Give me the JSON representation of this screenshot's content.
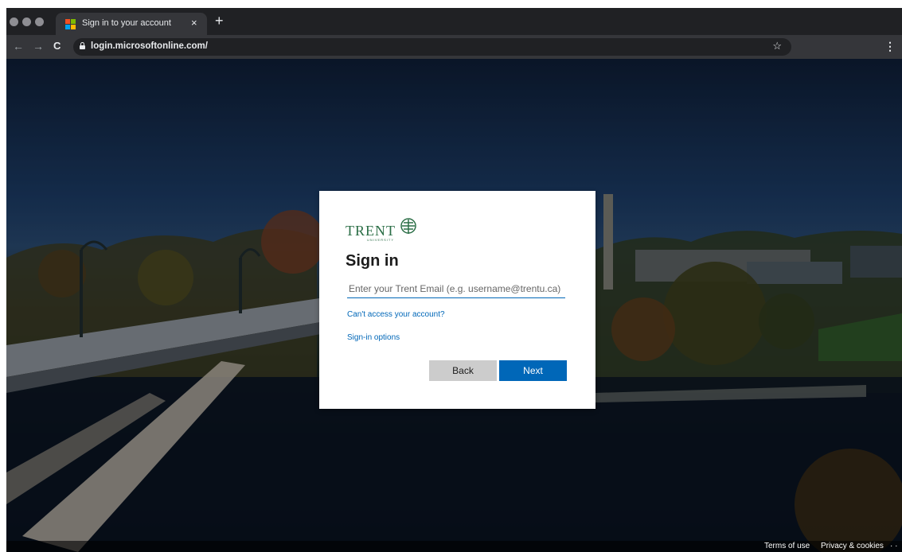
{
  "browser": {
    "tab": {
      "title": "Sign in to your account",
      "close": "×",
      "favicon_colors": [
        "#f25022",
        "#7fba00",
        "#00a4ef",
        "#ffb900"
      ]
    },
    "new_tab": "+",
    "nav": {
      "back": "←",
      "forward": "→",
      "reload": "C"
    },
    "url": "login.microsoftonline.com/",
    "bookmark": "☆",
    "menu": "⋮"
  },
  "signin": {
    "logo": {
      "word": "TRENT",
      "sub": "UNIVERSITY"
    },
    "heading": "Sign in",
    "email_placeholder": "Enter your Trent Email (e.g. username@trentu.ca)",
    "cant_access": "Can't access your account?",
    "signin_options": "Sign-in options",
    "back": "Back",
    "next": "Next",
    "accent": "#0067b8",
    "brand": "#2b6e46"
  },
  "footer": {
    "terms": "Terms of use",
    "privacy": "Privacy & cookies",
    "more": "· ·"
  }
}
